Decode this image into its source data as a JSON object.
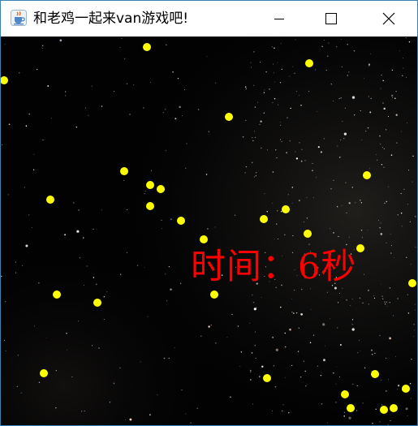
{
  "window": {
    "title": "和老鸡一起来van游戏吧!",
    "app_icon": "java-cup-icon",
    "controls": [
      "minimize-icon",
      "maximize-icon",
      "close-icon"
    ]
  },
  "game": {
    "background": "starfield",
    "timer_text": "时间：6秒",
    "ball_color": "#ffff00",
    "timer_color": "#ff0000"
  }
}
